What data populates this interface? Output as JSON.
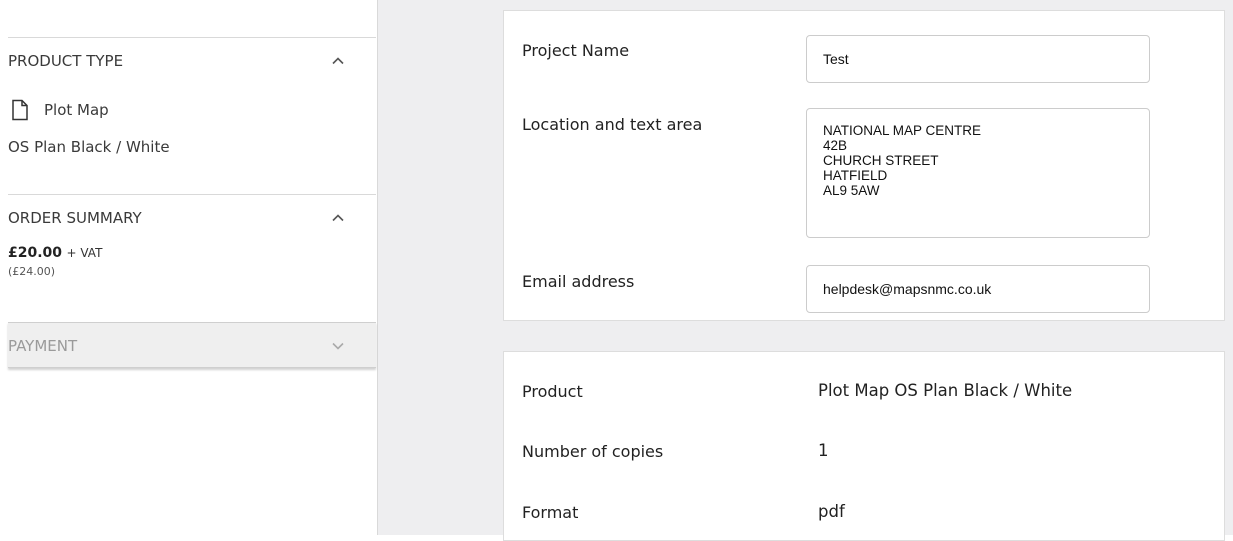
{
  "sidebar": {
    "product_type": {
      "title": "PRODUCT TYPE",
      "product_name": "Plot Map",
      "product_variant": "OS Plan Black / White",
      "icon": "document-icon"
    },
    "order_summary": {
      "title": "ORDER SUMMARY",
      "price": "£20.00",
      "vat_suffix": "+ VAT",
      "total_inc_vat": "(£24.00)"
    },
    "payment": {
      "title": "PAYMENT"
    }
  },
  "form": {
    "project_name": {
      "label": "Project Name",
      "value": "Test"
    },
    "location": {
      "label": "Location and text area",
      "value": "NATIONAL MAP CENTRE\n42B\nCHURCH STREET\nHATFIELD\nAL9 5AW"
    },
    "email": {
      "label": "Email address",
      "value": "helpdesk@mapsnmc.co.uk"
    }
  },
  "summary": {
    "rows": [
      {
        "label": "Product",
        "value": "Plot Map OS Plan Black / White"
      },
      {
        "label": "Number of copies",
        "value": "1"
      },
      {
        "label": "Format",
        "value": "pdf"
      }
    ]
  },
  "colors": {
    "main_bg": "#eeeef0",
    "payment_bg": "#efefef",
    "border": "#d9d9d9"
  }
}
